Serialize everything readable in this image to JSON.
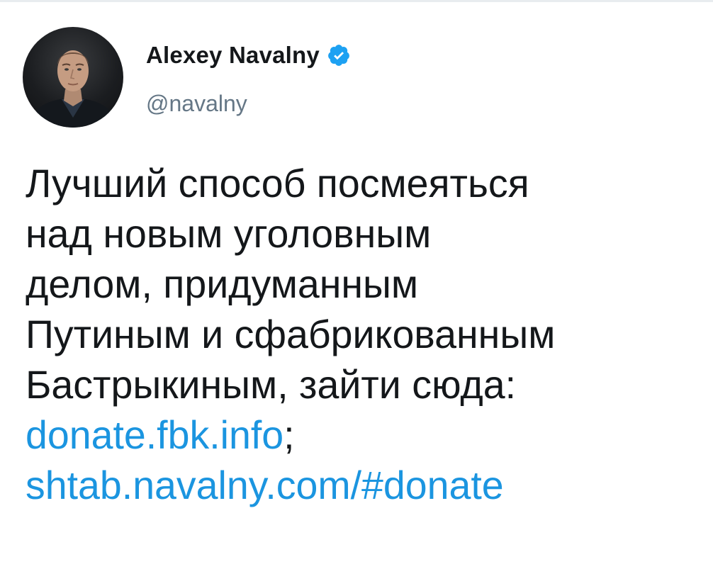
{
  "tweet": {
    "author": {
      "display_name": "Alexey Navalny",
      "handle": "@navalny",
      "verified": true
    },
    "text_lines": [
      "Лучший способ посмеяться",
      "над новым уголовным",
      "делом, придуманным",
      "Путиным и сфабрикованным",
      "Бастрыкиным, зайти сюда:"
    ],
    "link_1": "donate.fbk.info",
    "link_1_suffix": ";",
    "link_2": "shtab.navalny.com/#donate"
  },
  "colors": {
    "link": "#1b95e0",
    "verified_badge": "#1da1f2",
    "handle": "#657786",
    "text": "#14171a"
  },
  "icons": {
    "verified": "verified-badge-icon"
  }
}
